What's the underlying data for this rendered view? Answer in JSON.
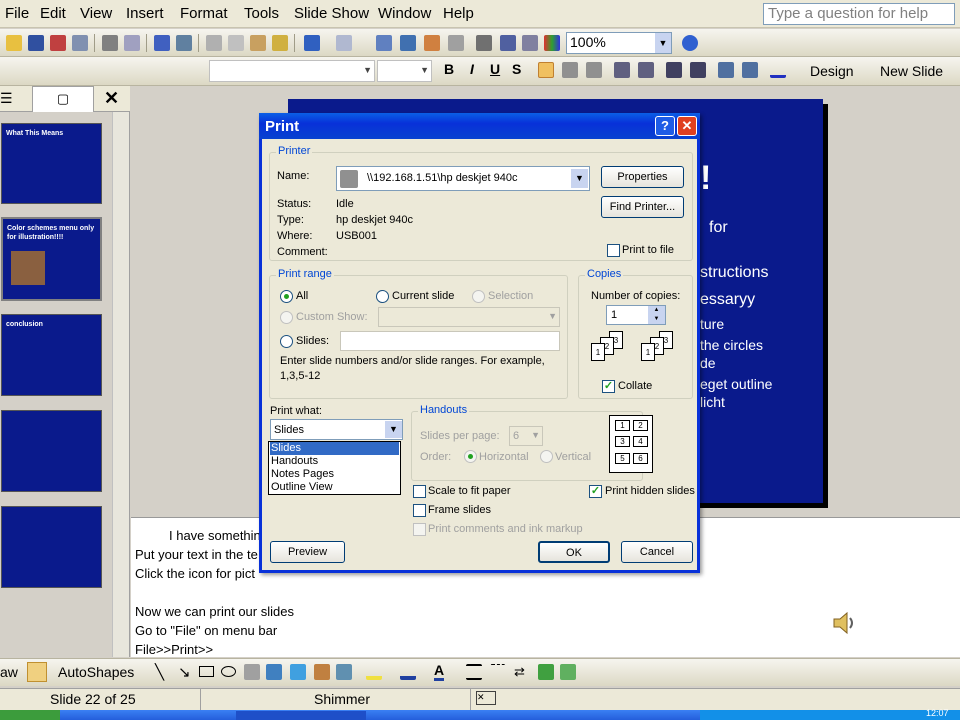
{
  "menubar": {
    "items": [
      "File",
      "Edit",
      "View",
      "Insert",
      "Format",
      "Tools",
      "Slide Show",
      "Window",
      "Help"
    ],
    "help_placeholder": "Type a question for help"
  },
  "toolbar": {
    "zoom": "100%",
    "design_label": "Design",
    "new_slide_label": "New Slide",
    "bold": "B",
    "italic": "I",
    "underline": "U",
    "shadow": "S"
  },
  "slides_panel": {
    "thumbs": [
      {
        "title": "What This Means"
      },
      {
        "title": "Color schemes menu only for illustration!!!!"
      },
      {
        "title": "conclusion"
      },
      {
        "title": ""
      },
      {
        "title": ""
      }
    ]
  },
  "slide": {
    "lines": [
      "!",
      "for",
      "structions",
      "essaryy",
      "ture",
      "the circles",
      "de",
      "eget outline",
      "licht"
    ]
  },
  "notes": {
    "lines": [
      "I have somethin",
      "Put your text in the te",
      "Click the icon for pict",
      "",
      "Now we can print our slides",
      "Go to \"File\" on menu bar",
      "File>>Print>>"
    ]
  },
  "drawbar": {
    "draw_label": "aw",
    "autoshapes_label": "AutoShapes"
  },
  "status": {
    "slide": "Slide 22 of 25",
    "design": "Shimmer"
  },
  "taskbar": {
    "time": "12:07"
  },
  "dialog": {
    "title": "Print",
    "printer": {
      "group": "Printer",
      "name_label": "Name:",
      "name_value": "\\\\192.168.1.51\\hp deskjet 940c",
      "status_label": "Status:",
      "status_value": "Idle",
      "type_label": "Type:",
      "type_value": "hp deskjet 940c",
      "where_label": "Where:",
      "where_value": "USB001",
      "comment_label": "Comment:",
      "properties_button": "Properties",
      "find_printer_button": "Find Printer...",
      "print_to_file": "Print to file"
    },
    "range": {
      "group": "Print range",
      "all": "All",
      "current": "Current slide",
      "selection": "Selection",
      "custom": "Custom Show:",
      "slides": "Slides:",
      "hint1": "Enter slide numbers and/or slide ranges. For example,",
      "hint2": "1,3,5-12"
    },
    "copies": {
      "group": "Copies",
      "number_label": "Number of copies:",
      "number_value": "1",
      "collate": "Collate"
    },
    "print_what": {
      "label": "Print what:",
      "value": "Slides",
      "options": [
        "Slides",
        "Handouts",
        "Notes Pages",
        "Outline View"
      ]
    },
    "handouts": {
      "group": "Handouts",
      "per_page_label": "Slides per page:",
      "per_page_value": "6",
      "order_label": "Order:",
      "horizontal": "Horizontal",
      "vertical": "Vertical"
    },
    "scale": "Scale to fit paper",
    "frame": "Frame slides",
    "comments": "Print comments and ink markup",
    "hidden": "Print hidden slides",
    "preview_button": "Preview",
    "ok_button": "OK",
    "cancel_button": "Cancel"
  }
}
